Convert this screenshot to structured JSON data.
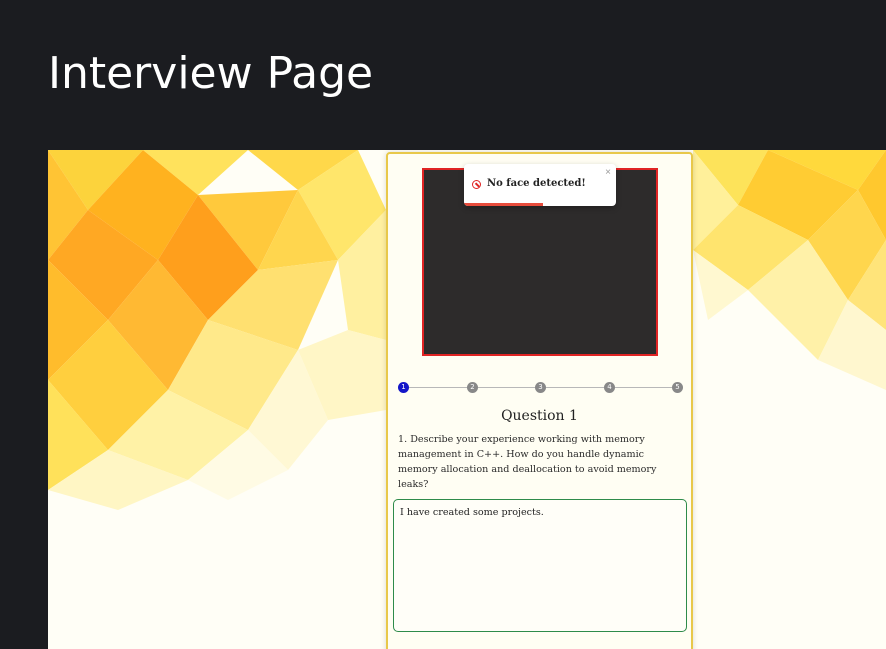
{
  "page": {
    "title": "Interview Page"
  },
  "video": {
    "status": "no-face",
    "border_color": "#e02424"
  },
  "toast": {
    "message": "No face detected!",
    "close": "×",
    "icon": "ban-icon",
    "progress": 0.52
  },
  "stepper": {
    "steps": [
      "1",
      "2",
      "3",
      "4",
      "5"
    ],
    "active": 1
  },
  "question": {
    "title": "Question 1",
    "text": "1. Describe your experience working with memory management in C++. How do you handle dynamic memory allocation and deallocation to avoid memory leaks?"
  },
  "answer": {
    "value": "I have created some projects."
  },
  "colors": {
    "header_bg": "#1b1c20",
    "active_step": "#1416c8",
    "answer_border": "#2e8b4a",
    "card_border": "#e8c84a"
  }
}
